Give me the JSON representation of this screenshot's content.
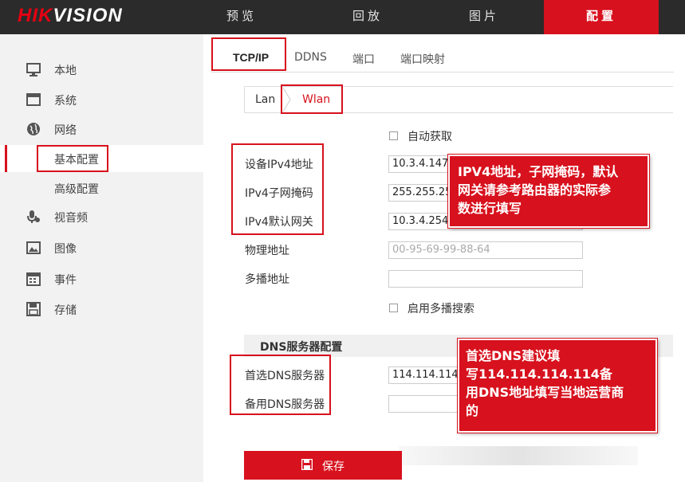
{
  "header": {
    "logo": "HIKVISION",
    "nav": [
      {
        "label": "预览",
        "active": false
      },
      {
        "label": "回放",
        "active": false
      },
      {
        "label": "图片",
        "active": false
      },
      {
        "label": "配置",
        "active": true
      }
    ]
  },
  "sidebar": {
    "items": [
      {
        "label": "本地",
        "icon": "monitor-icon"
      },
      {
        "label": "系统",
        "icon": "window-icon"
      },
      {
        "label": "网络",
        "icon": "globe-icon"
      },
      {
        "label": "视音频",
        "icon": "microphone-icon"
      },
      {
        "label": "图像",
        "icon": "image-icon"
      },
      {
        "label": "事件",
        "icon": "calendar-icon"
      },
      {
        "label": "存储",
        "icon": "disk-icon"
      }
    ],
    "subitems": [
      {
        "label": "基本配置",
        "active": true
      },
      {
        "label": "高级配置",
        "active": false
      }
    ]
  },
  "tabs": [
    "TCP/IP",
    "DDNS",
    "端口",
    "端口映射"
  ],
  "subtabs": [
    "Lan",
    "Wlan"
  ],
  "form": {
    "auto_label": "自动获取",
    "ipv4_label": "设备IPv4地址",
    "ipv4_value": "10.3.4.147",
    "mask_label": "IPv4子网掩码",
    "mask_value": "255.255.255.0",
    "gateway_label": "IPv4默认网关",
    "gateway_value": "10.3.4.254",
    "mac_label": "物理地址",
    "mac_value": "00-95-69-99-88-64",
    "multicast_label": "多播地址",
    "multicast_value": "",
    "multicast_search_label": "启用多播搜索",
    "dns_section": "DNS服务器配置",
    "dns1_label": "首选DNS服务器",
    "dns1_value": "114.114.114.114",
    "dns2_label": "备用DNS服务器",
    "dns2_value": ""
  },
  "callouts": {
    "ip": [
      "IPV4地址，子网掩码，默认",
      "网关请参考路由器的实际参",
      "数进行填写"
    ],
    "dns": [
      "首选DNS建议填",
      "写114.114.114.114备",
      "用DNS地址填写当地运营商",
      "的"
    ]
  },
  "save_label": "保存",
  "colors": {
    "brand": "#d7111d",
    "topbar": "#2b2b2b",
    "sidebar": "#f2f2f2"
  }
}
